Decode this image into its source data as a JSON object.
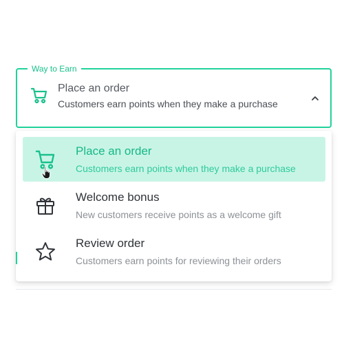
{
  "field": {
    "legend": "Way to Earn",
    "selected_title": "Place an order",
    "selected_subtitle": "Customers earn points when they make a purchase",
    "icon": "cart-icon",
    "caret_icon": "chevron-up-icon"
  },
  "dropdown": {
    "options": [
      {
        "title": "Place an order",
        "subtitle": "Customers earn points when they make a purchase",
        "icon": "cart-icon",
        "selected": true
      },
      {
        "title": "Welcome bonus",
        "subtitle": "New customers receive points as a welcome gift",
        "icon": "gift-icon",
        "selected": false
      },
      {
        "title": "Review order",
        "subtitle": "Customers earn points for reviewing their orders",
        "icon": "star-icon",
        "selected": false
      }
    ]
  },
  "colors": {
    "accent": "#1fd39b",
    "selected_bg": "#c8f4e6",
    "selected_text": "#16b885",
    "text_primary": "#2f3338",
    "text_secondary": "#8c9196"
  }
}
